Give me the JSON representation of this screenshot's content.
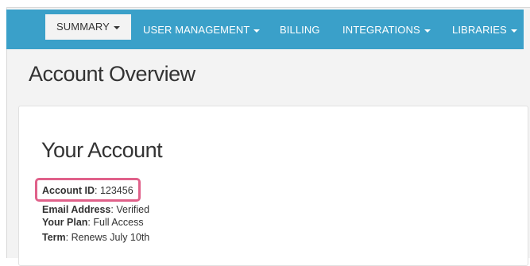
{
  "nav": {
    "tabs": [
      {
        "label": "SUMMARY",
        "dropdown": true,
        "active": true
      },
      {
        "label": "USER MANAGEMENT",
        "dropdown": true,
        "active": false
      },
      {
        "label": "BILLING",
        "dropdown": false,
        "active": false
      },
      {
        "label": "INTEGRATIONS",
        "dropdown": true,
        "active": false
      },
      {
        "label": "LIBRARIES",
        "dropdown": true,
        "active": false
      }
    ]
  },
  "page": {
    "title": "Account Overview"
  },
  "account": {
    "heading": "Your Account",
    "fields": [
      {
        "label": "Account ID",
        "value": "123456"
      },
      {
        "label": "Email Address",
        "value": "Verified"
      },
      {
        "label": "Your Plan",
        "value": "Full Access"
      },
      {
        "label": "Term",
        "value": "Renews July 10th"
      }
    ]
  },
  "colors": {
    "nav_bg": "#3aa0c9",
    "highlight": "#e0618a"
  }
}
